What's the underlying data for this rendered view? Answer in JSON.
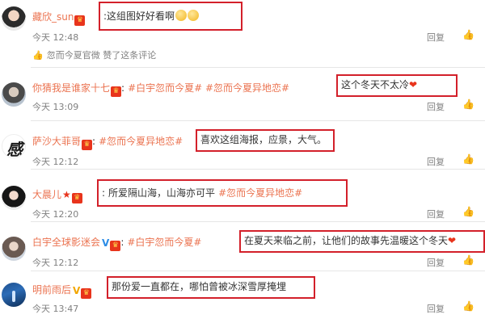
{
  "comments": [
    {
      "avatar": "avatar-girl-photo",
      "name": "藏欣_sun",
      "topics": "",
      "text": "这组图好好看啊",
      "time": "今天 12:48",
      "reply": "回复",
      "liked_by": "忽而今夏官微 赞了这条评论"
    },
    {
      "avatar": "avatar-boy-photo",
      "name": "你猜我是谁家十七",
      "topics": "#白宇忽而今夏# #忽而今夏异地恋#",
      "text": "这个冬天不太冷",
      "time": "今天 13:09",
      "reply": "回复"
    },
    {
      "avatar": "avatar-calligraphy",
      "name": "萨沙大菲哥",
      "topics": "#忽而今夏异地恋#",
      "text": "喜欢这组海报，应景，大气。",
      "time": "今天 12:12",
      "reply": "回复"
    },
    {
      "avatar": "avatar-woman-photo",
      "name": "大晨儿",
      "topics": "#忽而今夏异地恋#",
      "text": "所爱隔山海，山海亦可平",
      "time": "今天 12:20",
      "reply": "回复"
    },
    {
      "avatar": "avatar-man-photo",
      "name": "白宇全球影迷会",
      "topics": "#白宇忽而今夏#",
      "text": "在夏天来临之前，让他们的故事先温暖这个冬天",
      "time": "今天 12:12",
      "reply": "回复"
    },
    {
      "avatar": "avatar-blue-scene",
      "name": "明前雨后",
      "topics": "",
      "text": "那份爱一直都在，哪怕曾被冰深雪厚掩埋",
      "time": "今天 13:47",
      "reply": "回复"
    }
  ],
  "icons": {
    "badge": "red-member-badge",
    "like": "thumbs-up-icon",
    "verified_blue": "blue-v-verified-icon",
    "verified_gold": "gold-v-verified-icon",
    "heart": "red-heart-emoji",
    "clap": "clap-emoji"
  },
  "colors": {
    "username": "#eb7350",
    "highlight_box": "#d3202a",
    "meta_text": "#808080",
    "body_text": "#333333"
  }
}
